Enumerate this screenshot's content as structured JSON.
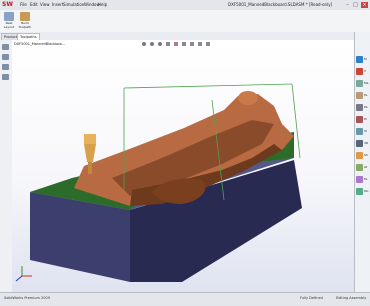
{
  "titlebar": {
    "logo": "SW",
    "menus": [
      "File",
      "Edit",
      "View",
      "Insert",
      "Simulation",
      "Window",
      "Help"
    ],
    "title": "DXF5001_MannedBlackboard.SLDASM * [Read-only]"
  },
  "commandbar": {
    "items": [
      {
        "label": "Nest Layout",
        "icon": "nest-icon"
      },
      {
        "label": "Build Toolpath",
        "icon": "toolpath-icon"
      }
    ]
  },
  "tabs": [
    {
      "label": "Products"
    },
    {
      "label": "Toolpaths"
    }
  ],
  "tree": {
    "root": "DXF5001_MannedBlackboa..."
  },
  "rightpanel": {
    "items": [
      "M",
      "V",
      "Ma",
      "Fe",
      "Pa",
      "Pr",
      "To",
      "3D",
      "Sh",
      "At",
      "Fe",
      "Mo"
    ]
  },
  "statusbar": {
    "left": "SolidWorks Premium 2009",
    "center": "Fully Defined",
    "right": "Editing Assembly"
  },
  "colors": {
    "stock_side": "#3c3f6e",
    "stock_front": "#55598a",
    "part_main": "#b86b43",
    "part_dark": "#6e3a1d",
    "part_green": "#2d6b2a",
    "tool_gold": "#e6b25a",
    "boundary": "#4da24d"
  }
}
